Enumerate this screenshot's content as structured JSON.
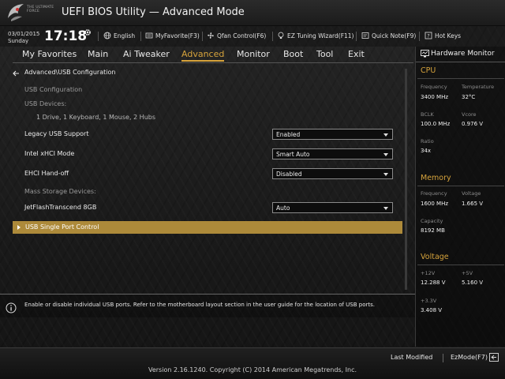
{
  "window": {
    "logo_text": "THE ULTIMATE FORCE",
    "title": "UEFI BIOS Utility — Advanced Mode"
  },
  "clock": {
    "date": "03/01/2015",
    "day": "Sunday",
    "time": "17:18"
  },
  "toolbar": {
    "language": "English",
    "my_favorite": "MyFavorite(F3)",
    "qfan": "Qfan Control(F6)",
    "ez_tuning": "EZ Tuning Wizard(F11)",
    "quick_note": "Quick Note(F9)",
    "hot_keys": "Hot Keys"
  },
  "menu": {
    "items": [
      "My Favorites",
      "Main",
      "Ai Tweaker",
      "Advanced",
      "Monitor",
      "Boot",
      "Tool",
      "Exit"
    ],
    "active": "Advanced"
  },
  "content": {
    "breadcrumb": "Advanced\\USB Configuration",
    "section_usb_config": "USB Configuration",
    "section_usb_devices": "USB Devices:",
    "usb_devices_value": "1 Drive, 1 Keyboard, 1 Mouse, 2 Hubs",
    "legacy_usb_label": "Legacy USB Support",
    "legacy_usb_value": "Enabled",
    "xhci_label": "Intel xHCI Mode",
    "xhci_value": "Smart Auto",
    "ehci_label": "EHCI Hand-off",
    "ehci_value": "Disabled",
    "mass_storage_label": "Mass Storage Devices:",
    "jetflash_label": "JetFlashTranscend 8GB",
    "jetflash_value": "Auto",
    "usb_single_port": "USB Single Port Control"
  },
  "help": {
    "text": "Enable or disable individual USB ports. Refer to the motherboard layout section in the user guide for the location of USB ports."
  },
  "hw_monitor": {
    "title": "Hardware Monitor",
    "cpu": {
      "heading": "CPU",
      "frequency_label": "Frequency",
      "frequency": "3400 MHz",
      "temperature_label": "Temperature",
      "temperature": "32°C",
      "bclk_label": "BCLK",
      "bclk": "100.0 MHz",
      "vcore_label": "Vcore",
      "vcore": "0.976 V",
      "ratio_label": "Ratio",
      "ratio": "34x"
    },
    "memory": {
      "heading": "Memory",
      "frequency_label": "Frequency",
      "frequency": "1600 MHz",
      "voltage_label": "Voltage",
      "voltage": "1.665 V",
      "capacity_label": "Capacity",
      "capacity": "8192 MB"
    },
    "voltage": {
      "heading": "Voltage",
      "v12_label": "+12V",
      "v12": "12.288 V",
      "v5_label": "+5V",
      "v5": "5.160 V",
      "v33_label": "+3.3V",
      "v33": "3.408 V"
    }
  },
  "footer": {
    "last_modified": "Last Modified",
    "ezmode": "EzMode(F7)",
    "version": "Version 2.16.1240. Copyright (C) 2014 American Megatrends, Inc."
  },
  "colors": {
    "accent": "#d6a33c",
    "highlight_row": "#ad8a3a"
  }
}
